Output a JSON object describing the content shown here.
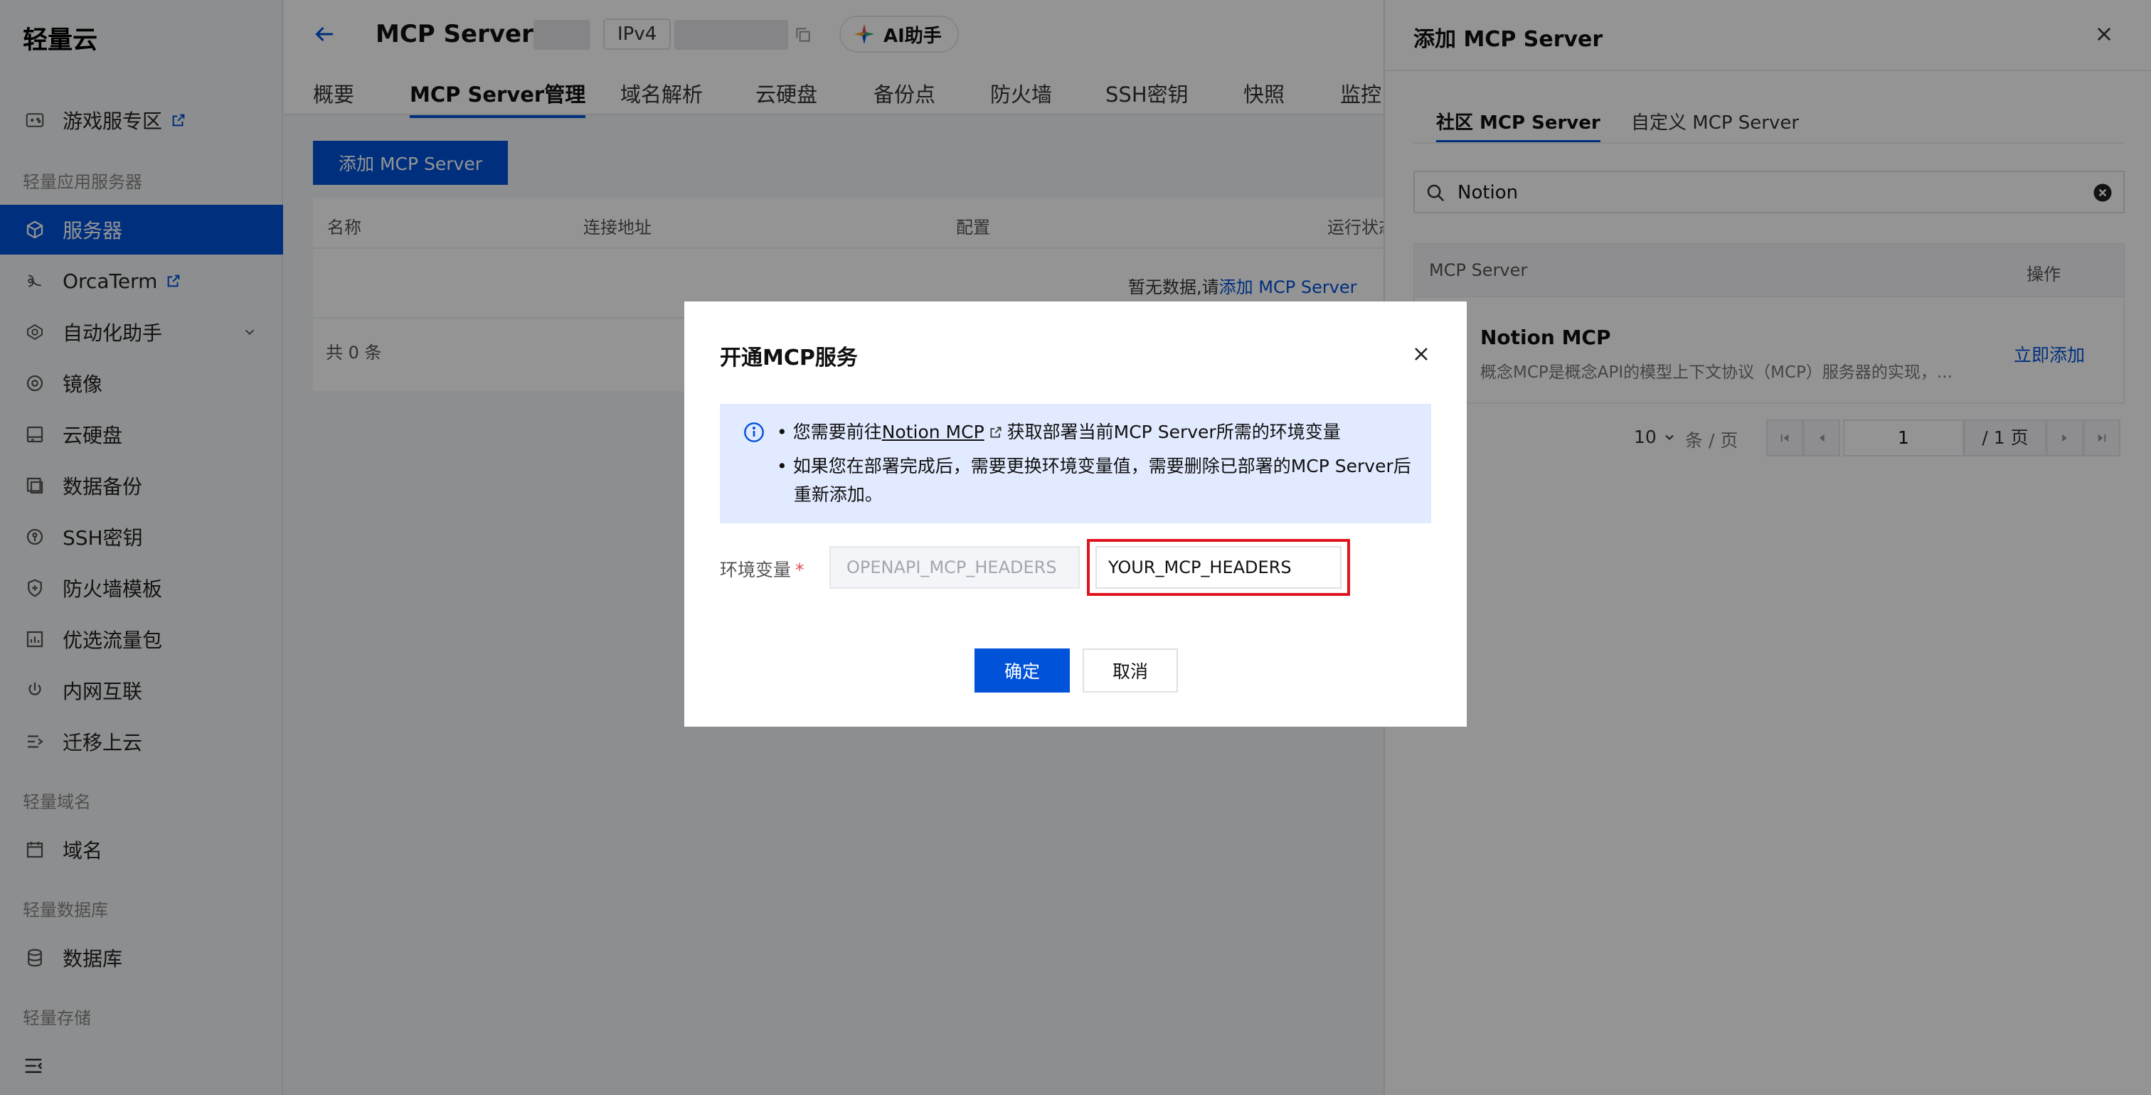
{
  "sidebar": {
    "brand": "轻量云",
    "items": [
      {
        "label": "游戏服专区",
        "icon": "gamepad-icon"
      },
      {
        "label": "服务器",
        "icon": "server-icon"
      },
      {
        "label": "OrcaTerm",
        "icon": "terminal-icon"
      },
      {
        "label": "自动化助手",
        "icon": "automation-icon"
      },
      {
        "label": "镜像",
        "icon": "image-icon"
      },
      {
        "label": "云硬盘",
        "icon": "disk-icon"
      },
      {
        "label": "数据备份",
        "icon": "backup-icon"
      },
      {
        "label": "SSH密钥",
        "icon": "key-icon"
      },
      {
        "label": "防火墙模板",
        "icon": "shield-icon"
      },
      {
        "label": "优选流量包",
        "icon": "traffic-icon"
      },
      {
        "label": "内网互联",
        "icon": "network-icon"
      },
      {
        "label": "迁移上云",
        "icon": "migrate-icon"
      },
      {
        "label": "域名",
        "icon": "domain-icon"
      },
      {
        "label": "数据库",
        "icon": "database-icon"
      }
    ],
    "groups": [
      "轻量应用服务器",
      "轻量域名",
      "轻量数据库",
      "轻量存储"
    ]
  },
  "header": {
    "title": "MCP Server",
    "ip_type": "IPv4",
    "ai_label": "AI助手"
  },
  "tabs": [
    "概要",
    "MCP Server管理",
    "域名解析",
    "云硬盘",
    "备份点",
    "防火墙",
    "SSH密钥",
    "快照",
    "监控"
  ],
  "main": {
    "add_button": "添加 MCP Server",
    "columns": [
      "名称",
      "连接地址",
      "配置",
      "运行状态"
    ],
    "empty_text": "暂无数据,请",
    "empty_link": "添加 MCP Server",
    "total": "共 0 条"
  },
  "drawer": {
    "title": "添加 MCP Server",
    "tabs": [
      "社区 MCP Server",
      "自定义 MCP Server"
    ],
    "search_value": "Notion",
    "columns": [
      "MCP Server",
      "操作"
    ],
    "row": {
      "name": "Notion MCP",
      "desc": "概念MCP是概念API的模型上下文协议（MCP）服务器的实现，...",
      "action": "立即添加"
    },
    "pager": {
      "total": "条",
      "size": "10",
      "unit": "条 / 页",
      "page": "1",
      "of": "/ 1 页"
    }
  },
  "modal": {
    "title": "开通MCP服务",
    "bullet1_pre": "您需要前往",
    "bullet1_link": "Notion MCP",
    "bullet1_post": "获取部署当前MCP Server所需的环境变量",
    "bullet2_line1": "如果您在部署完成后，需要更换环境变量值，需要删除已部署的MCP Server后",
    "bullet2_line2": "重新添加。",
    "env_label": "环境变量",
    "env_key": "OPENAPI_MCP_HEADERS",
    "env_value": "YOUR_MCP_HEADERS",
    "ok": "确定",
    "cancel": "取消"
  },
  "colors": {
    "primary": "#0052d9",
    "alert_bg": "#e2eaff",
    "highlight": "#e0141e",
    "required": "#e34d59"
  }
}
